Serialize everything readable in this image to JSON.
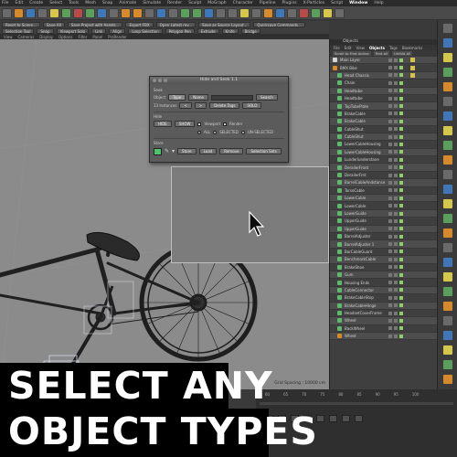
{
  "menubar": [
    "File",
    "Edit",
    "Create",
    "Select",
    "Tools",
    "Mesh",
    "Snap",
    "Animate",
    "Simulate",
    "Render",
    "Sculpt",
    "MoGraph",
    "Character",
    "Pipeline",
    "Plugins",
    "X-Particles",
    "Script",
    "Window",
    "Help"
  ],
  "menubar_active": "Window",
  "toolbar_icons": [
    "undo-icon",
    "redo-icon",
    "live-selection-icon",
    "move-icon",
    "scale-icon",
    "rotate-icon",
    "x-axis-icon",
    "y-axis-icon",
    "z-axis-icon",
    "coordinate-icon",
    "render-view-icon",
    "render-picture-icon",
    "render-settings-icon",
    "cube-icon",
    "pen-icon",
    "subdivision-icon",
    "cloner-icon",
    "deformer-icon",
    "scene-icon",
    "camera-icon",
    "light-icon",
    "floor-icon",
    "python-icon",
    "xp-icon",
    "cache-icon",
    "emitter-icon",
    "generator-icon",
    "field-icon",
    "tag-icon"
  ],
  "plugin_row1": [
    "Reset to Scene...",
    "Save All",
    "Save Project with Assets...",
    "Export FBX",
    "Open Latest rev...",
    "Save as Source Layout...",
    "Quicksave Commands..."
  ],
  "plugin_row2": [
    "Selection Tool",
    "Snap",
    "Viewport Solo",
    "Link",
    "Align",
    "Loop Selection",
    "Polygon Pen",
    "Extrude",
    "Knife",
    "Bridge"
  ],
  "viewport_tabs": [
    "View",
    "Cameras",
    "Display",
    "Options",
    "Filter",
    "Panel",
    "ProRender"
  ],
  "viewport": {
    "grid_spacing": "Grid Spacing : 10000 cm"
  },
  "dialog": {
    "title": "Hide and Seek 1.1",
    "seek_label": "Seek",
    "object_label": "Object",
    "type_label": "Type",
    "name_label": "Name",
    "name_value": "",
    "search_button": "Search",
    "instances_label": "13 Instances",
    "prev_button": "<",
    "next_button": ">",
    "delete_tags_button": "Delete Tags",
    "solo_button": "SOLO",
    "hide_section": "Hide",
    "hide_button": "HIDE",
    "show_button": "SHOW",
    "viewport_option": "Viewport",
    "render_option": "Render",
    "all_option": "ALL",
    "selected_option": "SELECTED",
    "unselected_option": "UN-SELECTED",
    "store_section": "Store",
    "store_button": "Store",
    "load_button": "Load",
    "remove_button": "Remove",
    "selection_sets_button": "Selection Sets",
    "swatch_color": "#4cc66a"
  },
  "object_manager": {
    "window_title": "Objects",
    "menu": [
      "File",
      "Edit",
      "View",
      "Objects",
      "Tags",
      "Bookmarks"
    ],
    "menu_active": "Objects",
    "tools": [
      "Scroll to First Active",
      "Find all",
      "Unfold All"
    ],
    "rows": [
      {
        "name": "Main Layer",
        "ico": "#d6d6d6",
        "tag": true
      },
      {
        "name": "BMX Bike",
        "ico": "#d88a2a",
        "tag": true
      },
      {
        "name": "Head Chassis",
        "ico": "#5fb86a",
        "tag": true
      },
      {
        "name": "Chain",
        "ico": "#5fb86a",
        "tag": false
      },
      {
        "name": "Headtube",
        "ico": "#5fb86a",
        "tag": false
      },
      {
        "name": "Headtube",
        "ico": "#5fb86a",
        "tag": false
      },
      {
        "name": "TopTubePlate",
        "ico": "#5fb86a",
        "tag": false
      },
      {
        "name": "BrakeCable",
        "ico": "#5fb86a",
        "tag": false
      },
      {
        "name": "BrakeCable",
        "ico": "#5fb86a",
        "tag": false
      },
      {
        "name": "CableShut",
        "ico": "#5fb86a",
        "tag": false
      },
      {
        "name": "CableShut",
        "ico": "#5fb86a",
        "tag": false
      },
      {
        "name": "LowerCableHousing",
        "ico": "#5fb86a",
        "tag": false
      },
      {
        "name": "LowerCableHousing",
        "ico": "#5fb86a",
        "tag": false
      },
      {
        "name": "Lunderlunderstane",
        "ico": "#5fb86a",
        "tag": false
      },
      {
        "name": "DerailerFront",
        "ico": "#5fb86a",
        "tag": false
      },
      {
        "name": "DerailerFrnt",
        "ico": "#5fb86a",
        "tag": false
      },
      {
        "name": "BarrelCableAndstance",
        "ico": "#5fb86a",
        "tag": false
      },
      {
        "name": "TorsoCable",
        "ico": "#5fb86a",
        "tag": false
      },
      {
        "name": "LowerCable",
        "ico": "#5fb86a",
        "tag": false
      },
      {
        "name": "LowerCable",
        "ico": "#5fb86a",
        "tag": false
      },
      {
        "name": "LowerGuide",
        "ico": "#5fb86a",
        "tag": false
      },
      {
        "name": "UpperGuide",
        "ico": "#5fb86a",
        "tag": false
      },
      {
        "name": "UpperGuide",
        "ico": "#5fb86a",
        "tag": false
      },
      {
        "name": "BarrelAdjuster",
        "ico": "#5fb86a",
        "tag": false
      },
      {
        "name": "BarrelAdjuster 1",
        "ico": "#5fb86a",
        "tag": false
      },
      {
        "name": "BarCableGuard",
        "ico": "#5fb86a",
        "tag": false
      },
      {
        "name": "BenchmarkCable",
        "ico": "#5fb86a",
        "tag": false
      },
      {
        "name": "BrakeShoe",
        "ico": "#5fb86a",
        "tag": false
      },
      {
        "name": "Gum",
        "ico": "#5fb86a",
        "tag": false
      },
      {
        "name": "Housing Ends",
        "ico": "#5fb86a",
        "tag": false
      },
      {
        "name": "CableConnector",
        "ico": "#5fb86a",
        "tag": false
      },
      {
        "name": "BrakeCableStop",
        "ico": "#5fb86a",
        "tag": false
      },
      {
        "name": "BrakeCableHinge",
        "ico": "#5fb86a",
        "tag": false
      },
      {
        "name": "HeadsetCoverFrame",
        "ico": "#5fb86a",
        "tag": false
      },
      {
        "name": "Wheel",
        "ico": "#5fb86a",
        "tag": false
      },
      {
        "name": "BackWheel",
        "ico": "#5fb86a",
        "tag": false
      },
      {
        "name": "Wheel",
        "ico": "#d88a2a",
        "tag": false
      }
    ]
  },
  "timeline": {
    "ticks": [
      "60",
      "65",
      "70",
      "75",
      "80",
      "85",
      "90",
      "95",
      "100"
    ]
  },
  "caption": {
    "line1": "SELECT ANY",
    "line2": "OBJECT TYPES"
  },
  "colors": {
    "viewport_bg": "#8b8b8b",
    "caption_bg": "#000000",
    "accent_orange": "#d88a2a",
    "object_green": "#5fb86a"
  }
}
